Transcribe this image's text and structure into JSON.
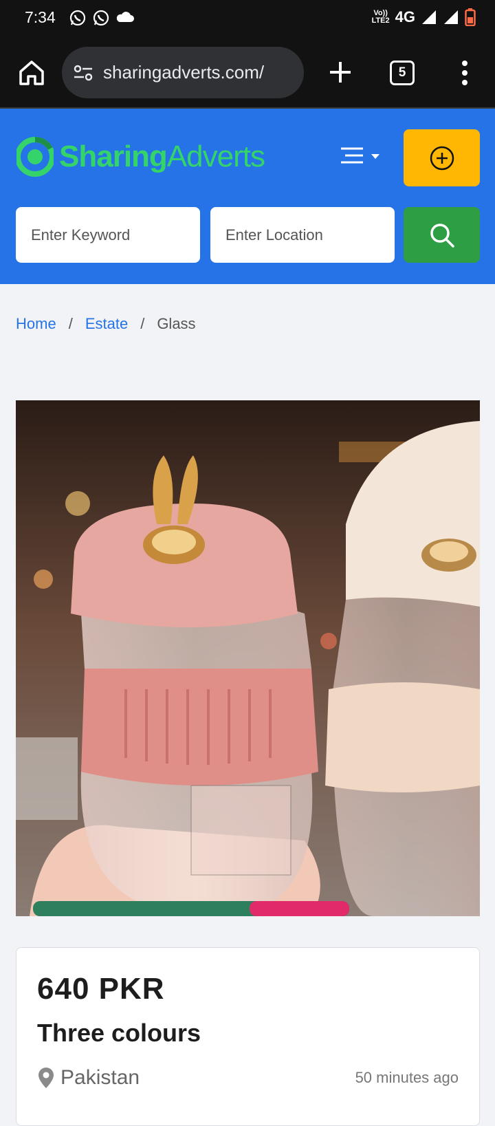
{
  "status_bar": {
    "time": "7:34",
    "volte_line1": "Vo))",
    "volte_line2": "LTE2",
    "network": "4G",
    "icons": [
      "whatsapp-icon",
      "whatsapp-icon",
      "cloud-icon",
      "wifi-signal-icon",
      "cell-signal-icon",
      "battery-icon"
    ]
  },
  "browser": {
    "url": "sharingadverts.com/",
    "tab_count": "5",
    "icons": [
      "home-icon",
      "site-settings-icon",
      "plus-icon",
      "tabs-icon",
      "more-vert-icon"
    ]
  },
  "header": {
    "logo_part1": "Sharing",
    "logo_part2": "Adverts",
    "keyword_placeholder": "Enter Keyword",
    "location_placeholder": "Enter Location",
    "colors": {
      "header_bg": "#2673e8",
      "post_button": "#ffb703",
      "search_button": "#2e9e45",
      "logo": "#34d46a"
    }
  },
  "breadcrumb": {
    "items": [
      "Home",
      "Estate",
      "Glass"
    ],
    "separator": "/"
  },
  "listing": {
    "price": "640 PKR",
    "title": "Three colours",
    "location": "Pakistan",
    "posted": "50 minutes ago"
  }
}
